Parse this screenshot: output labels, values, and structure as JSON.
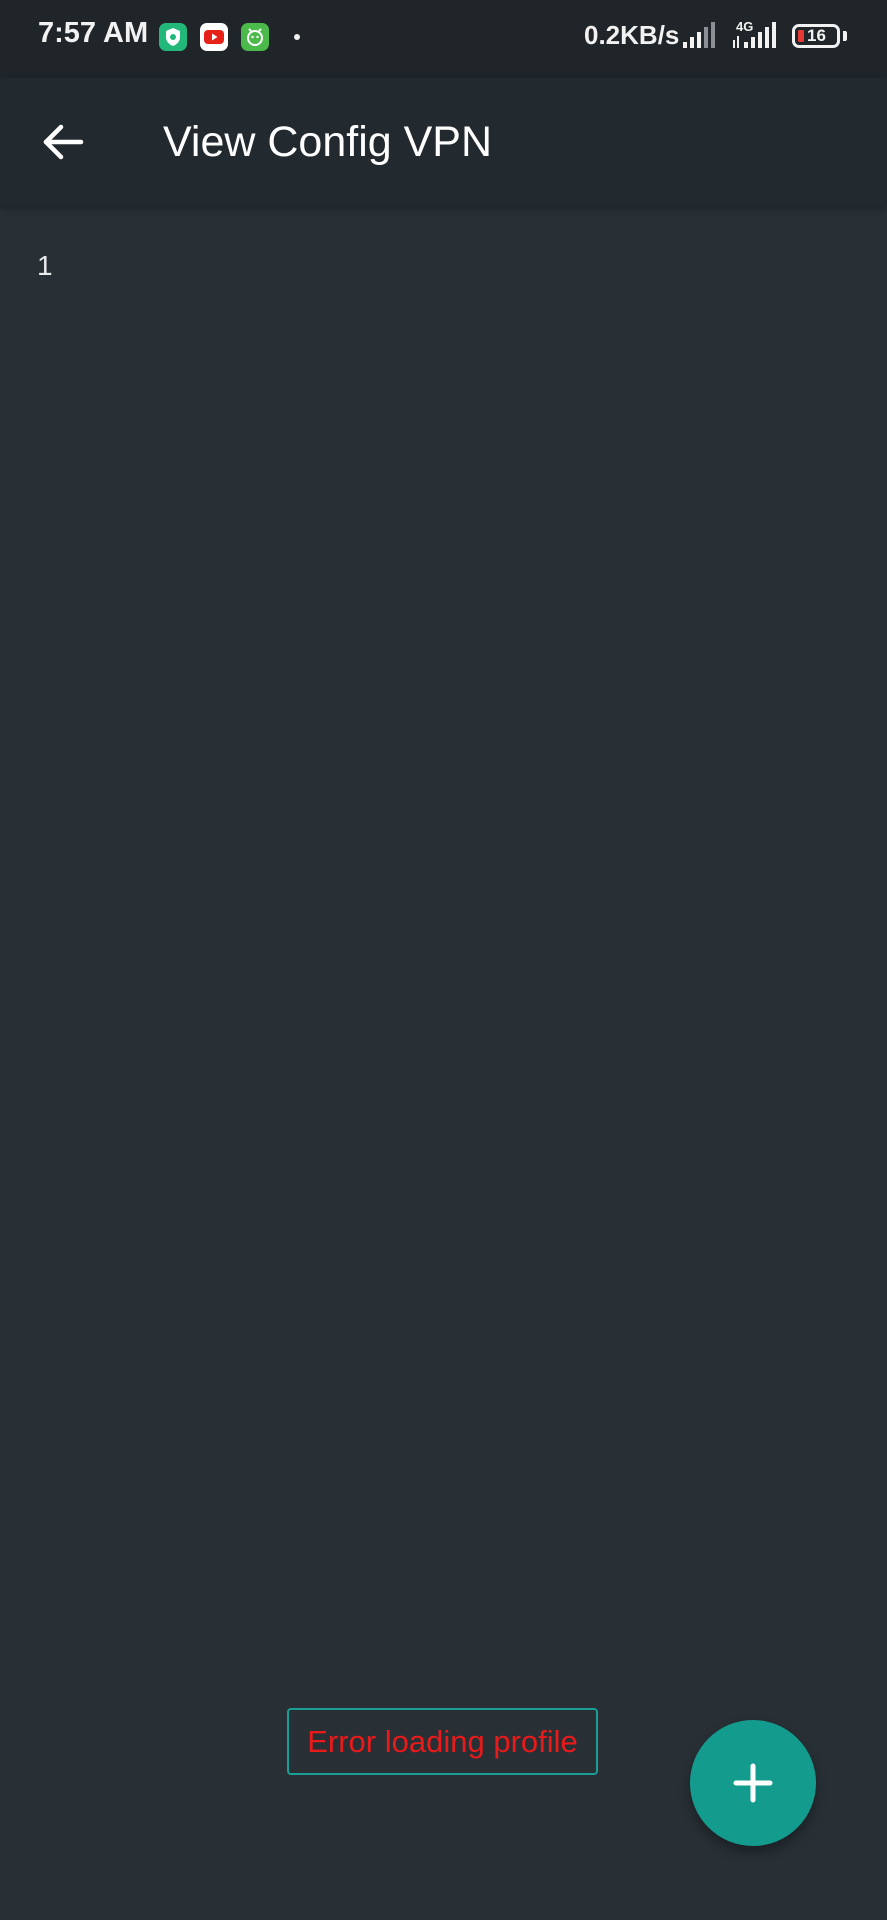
{
  "status_bar": {
    "time": "7:57 AM",
    "net_speed": "0.2KB/s",
    "network_type": "4G",
    "battery_level": "16",
    "notification_icons": [
      "vpn-shield-icon",
      "youtube-icon",
      "android-app-icon"
    ]
  },
  "app_bar": {
    "title": "View Config VPN",
    "back_icon": "arrow-left-icon"
  },
  "config_list": {
    "items": [
      "1"
    ]
  },
  "toast": {
    "message": "Error loading profile"
  },
  "fab": {
    "icon": "plus-icon"
  },
  "colors": {
    "background": "#283036",
    "app_bar": "#232a2f",
    "status_bar": "#1f2529",
    "accent": "#139c8e",
    "error": "#e81a1a"
  }
}
